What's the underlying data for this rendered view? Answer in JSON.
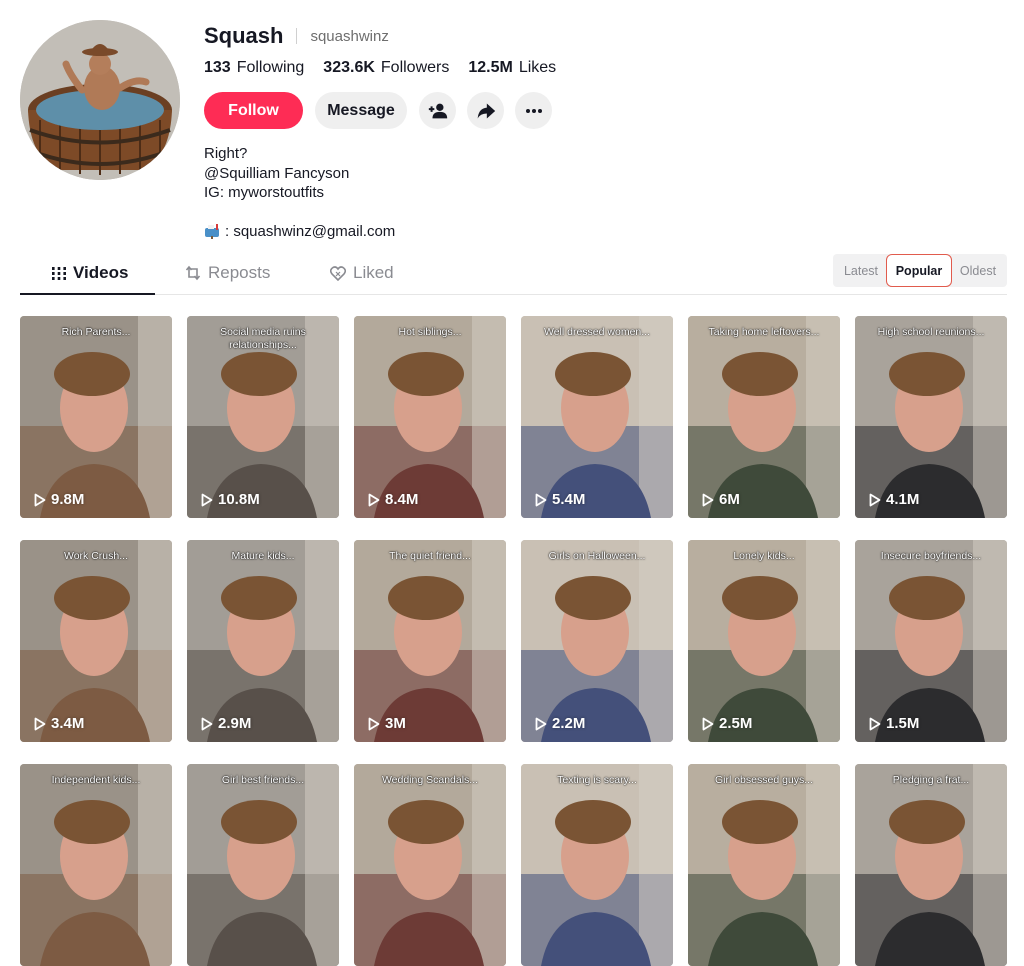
{
  "profile": {
    "display_name": "Squash",
    "username": "squashwinz",
    "following_count": "133",
    "following_label": "Following",
    "followers_count": "323.6K",
    "followers_label": "Followers",
    "likes_count": "12.5M",
    "likes_label": "Likes",
    "bio_lines": [
      "Right?",
      "@Squilliam Fancyson",
      "IG: myworstoutfits"
    ],
    "email": ": squashwinz@gmail.com"
  },
  "actions": {
    "follow_label": "Follow",
    "message_label": "Message",
    "add_friend_icon": "add-user-icon",
    "share_icon": "share-icon",
    "more_icon": "more-icon"
  },
  "tabs": [
    {
      "label": "Videos",
      "icon": "grid-icon",
      "active": true
    },
    {
      "label": "Reposts",
      "icon": "repost-icon",
      "active": false
    },
    {
      "label": "Liked",
      "icon": "heart-icon",
      "active": false
    }
  ],
  "sort": [
    {
      "label": "Latest",
      "active": false
    },
    {
      "label": "Popular",
      "active": true
    },
    {
      "label": "Oldest",
      "active": false
    }
  ],
  "colors": {
    "accent": "#fe2c55",
    "sort_highlight": "#e15b4d"
  },
  "videos": [
    {
      "caption": "Rich Parents...",
      "views": "9.8M"
    },
    {
      "caption": "Social media ruins relationships...",
      "views": "10.8M"
    },
    {
      "caption": "Hot siblings...",
      "views": "8.4M"
    },
    {
      "caption": "Well dressed women...",
      "views": "5.4M"
    },
    {
      "caption": "Taking home leftovers...",
      "views": "6M"
    },
    {
      "caption": "High school reunions...",
      "views": "4.1M"
    },
    {
      "caption": "Work Crush...",
      "views": "3.4M"
    },
    {
      "caption": "Mature kids...",
      "views": "2.9M"
    },
    {
      "caption": "The quiet friend...",
      "views": "3M"
    },
    {
      "caption": "Girls on Halloween...",
      "views": "2.2M"
    },
    {
      "caption": "Lonely kids...",
      "views": "2.5M"
    },
    {
      "caption": "Insecure boyfriends...",
      "views": "1.5M"
    },
    {
      "caption": "Independent kids...",
      "views": ""
    },
    {
      "caption": "Girl best friends...",
      "views": ""
    },
    {
      "caption": "Wedding Scandals...",
      "views": ""
    },
    {
      "caption": "Texting is scary...",
      "views": ""
    },
    {
      "caption": "Girl obsessed guys...",
      "views": ""
    },
    {
      "caption": "Pledging a frat...",
      "views": ""
    }
  ]
}
